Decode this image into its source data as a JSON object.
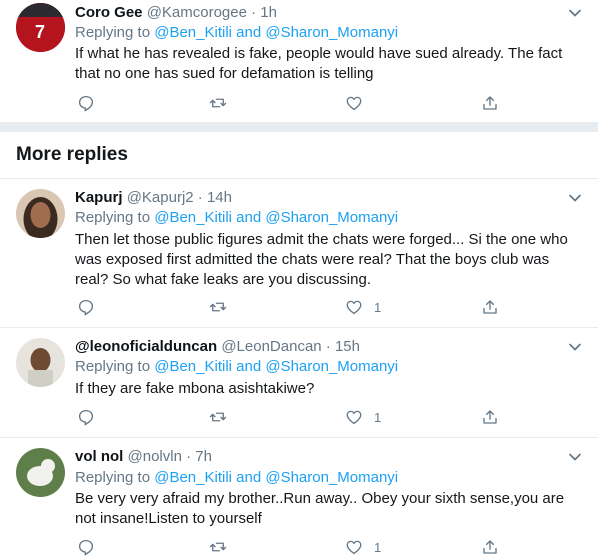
{
  "replying_prefix": "Replying to ",
  "reply_link": "@Ben_Kitili and @Sharon_Momanyi",
  "more_replies_title": "More replies",
  "tweets": [
    {
      "name": "Coro Gee",
      "handle": "@Kamcorogee · 1h",
      "text": "If what he has revealed is fake, people would have sued already. The fact that no one has sued for defamation is telling",
      "like_count": ""
    },
    {
      "name": "Kapurj",
      "handle": "@Kapurj2 · 14h",
      "text": "Then let those public figures admit the chats were forged... Si the one who was exposed first admitted the chats were real? That the boys club was real? So what fake leaks are you discussing.",
      "like_count": "1"
    },
    {
      "name": "@leonoficialduncan",
      "handle": "@LeonDancan · 15h",
      "text": "If they are fake mbona asishtakiwe?",
      "like_count": "1"
    },
    {
      "name": "vol nol",
      "handle": "@nolvln · 7h",
      "text": "Be very very afraid my brother..Run away.. Obey your sixth sense,you are not insane!Listen to yourself",
      "like_count": "1"
    }
  ],
  "colors": {
    "link": "#1da1f2",
    "secondary_text": "#657786",
    "divider": "#e6ecf0"
  }
}
